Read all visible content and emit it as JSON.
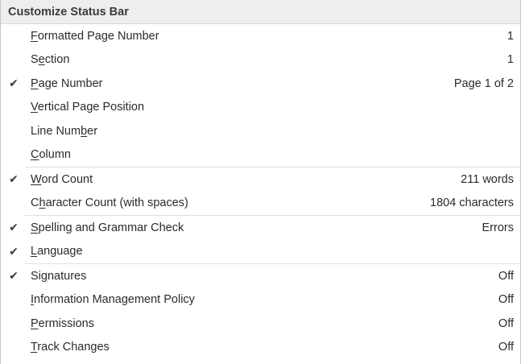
{
  "menu": {
    "title": "Customize Status Bar",
    "check_glyph": "✔",
    "groups": [
      {
        "items": [
          {
            "pre": "",
            "key": "F",
            "post": "ormatted Page Number",
            "value": "1",
            "checked": false
          },
          {
            "pre": "S",
            "key": "e",
            "post": "ction",
            "value": "1",
            "checked": false
          },
          {
            "pre": "",
            "key": "P",
            "post": "age Number",
            "value": "Page 1 of 2",
            "checked": true
          },
          {
            "pre": "",
            "key": "V",
            "post": "ertical Page Position",
            "value": "",
            "checked": false
          },
          {
            "pre": "Line Num",
            "key": "b",
            "post": "er",
            "value": "",
            "checked": false
          },
          {
            "pre": "",
            "key": "C",
            "post": "olumn",
            "value": "",
            "checked": false
          }
        ]
      },
      {
        "items": [
          {
            "pre": "",
            "key": "W",
            "post": "ord Count",
            "value": "211 words",
            "checked": true
          },
          {
            "pre": "C",
            "key": "h",
            "post": "aracter Count (with spaces)",
            "value": "1804 characters",
            "checked": false
          }
        ]
      },
      {
        "items": [
          {
            "pre": "",
            "key": "S",
            "post": "pelling and Grammar Check",
            "value": "Errors",
            "checked": true
          },
          {
            "pre": "",
            "key": "L",
            "post": "anguage",
            "value": "",
            "checked": true
          }
        ]
      },
      {
        "items": [
          {
            "pre": "Si",
            "key": "g",
            "post": "natures",
            "value": "Off",
            "checked": true
          },
          {
            "pre": "",
            "key": "I",
            "post": "nformation Management Policy",
            "value": "Off",
            "checked": false
          },
          {
            "pre": "",
            "key": "P",
            "post": "ermissions",
            "value": "Off",
            "checked": false
          },
          {
            "pre": "",
            "key": "T",
            "post": "rack Changes",
            "value": "Off",
            "checked": false
          }
        ]
      }
    ]
  }
}
